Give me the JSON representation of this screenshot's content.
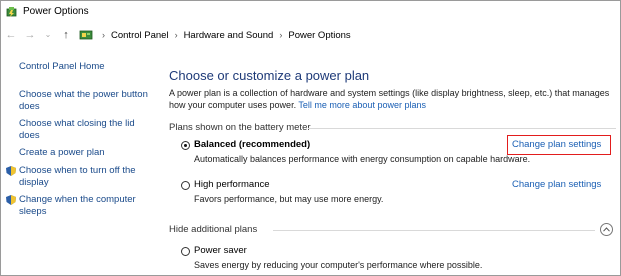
{
  "window": {
    "title": "Power Options"
  },
  "address": {
    "crumbs": [
      "Control Panel",
      "Hardware and Sound",
      "Power Options"
    ],
    "separator": "›"
  },
  "sidebar": {
    "home": "Control Panel Home",
    "links": [
      {
        "line1": "Choose what the power button",
        "line2": "does"
      },
      {
        "line1": "Choose what closing the lid",
        "line2": "does"
      },
      {
        "line1": "Create a power plan",
        "line2": ""
      },
      {
        "line1": "Choose when to turn off the",
        "line2": "display",
        "icon": "shield-icon"
      },
      {
        "line1": "Change when the computer",
        "line2": "sleeps",
        "icon": "shield-icon"
      }
    ]
  },
  "main": {
    "heading": "Choose or customize a power plan",
    "description_line1": "A power plan is a collection of hardware and system settings (like display brightness, sleep, etc.) that manages",
    "description_line2_prefix": "how your computer uses power. ",
    "description_link": "Tell me more about power plans",
    "group_label": "Plans shown on the battery meter",
    "plans": [
      {
        "name": "Balanced (recommended)",
        "selected": true,
        "description": "Automatically balances performance with energy consumption on capable hardware.",
        "link": "Change plan settings"
      },
      {
        "name": "High performance",
        "selected": false,
        "description": "Favors performance, but may use more energy.",
        "link": "Change plan settings"
      }
    ],
    "hide_label": "Hide additional plans",
    "additional_plans": [
      {
        "name": "Power saver",
        "selected": false,
        "description": "Saves energy by reducing your computer's performance where possible."
      }
    ]
  },
  "colors": {
    "link": "#1a5fb4",
    "heading": "#1e3a78",
    "highlight": "#e21d1d"
  }
}
